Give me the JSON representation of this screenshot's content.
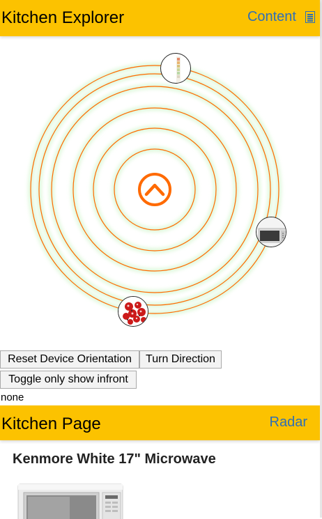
{
  "header": {
    "title": "Kitchen Explorer",
    "content_link": "Content",
    "menu_icon": "list-icon",
    "background": "#fcc200",
    "link_color": "#2f6fb5"
  },
  "radar": {
    "ring_color": "#ff6a00",
    "glow_color": "#d9f7d4",
    "center_icon": "chevron-up-circle-icon",
    "pois": [
      {
        "name": "poi-top",
        "icon": "spice-rack-icon"
      },
      {
        "name": "poi-right",
        "icon": "microwave-icon"
      },
      {
        "name": "poi-bottom",
        "icon": "flowers-icon"
      }
    ]
  },
  "controls": {
    "reset_label": "Reset Device Orientation",
    "turn_label": "Turn Direction",
    "toggle_label": "Toggle only show infront",
    "status_text": "none"
  },
  "page": {
    "title": "Kitchen Page",
    "radar_link": "Radar",
    "product_title": "Kenmore White 17\" Microwave"
  }
}
